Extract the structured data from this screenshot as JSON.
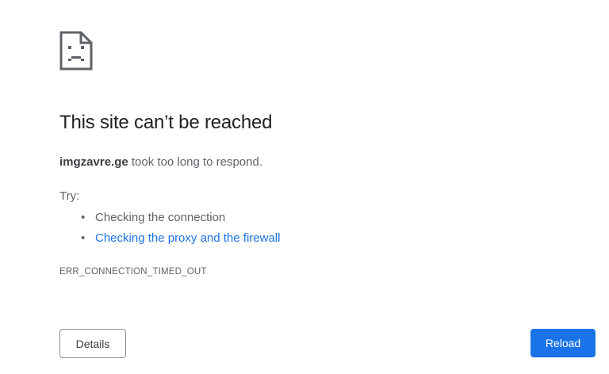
{
  "icon": "sad-page-icon",
  "title": "This site can’t be reached",
  "description": {
    "host": "imgzavre.ge",
    "message": " took too long to respond."
  },
  "try": {
    "label": "Try:",
    "items": [
      {
        "text": "Checking the connection",
        "is_link": false
      },
      {
        "text": "Checking the proxy and the firewall",
        "is_link": true
      }
    ]
  },
  "error_code": "ERR_CONNECTION_TIMED_OUT",
  "buttons": {
    "details": "Details",
    "reload": "Reload"
  },
  "colors": {
    "link": "#1a73e8",
    "primary_button": "#1a73e8",
    "text": "#202124",
    "secondary_text": "#5f6368"
  }
}
